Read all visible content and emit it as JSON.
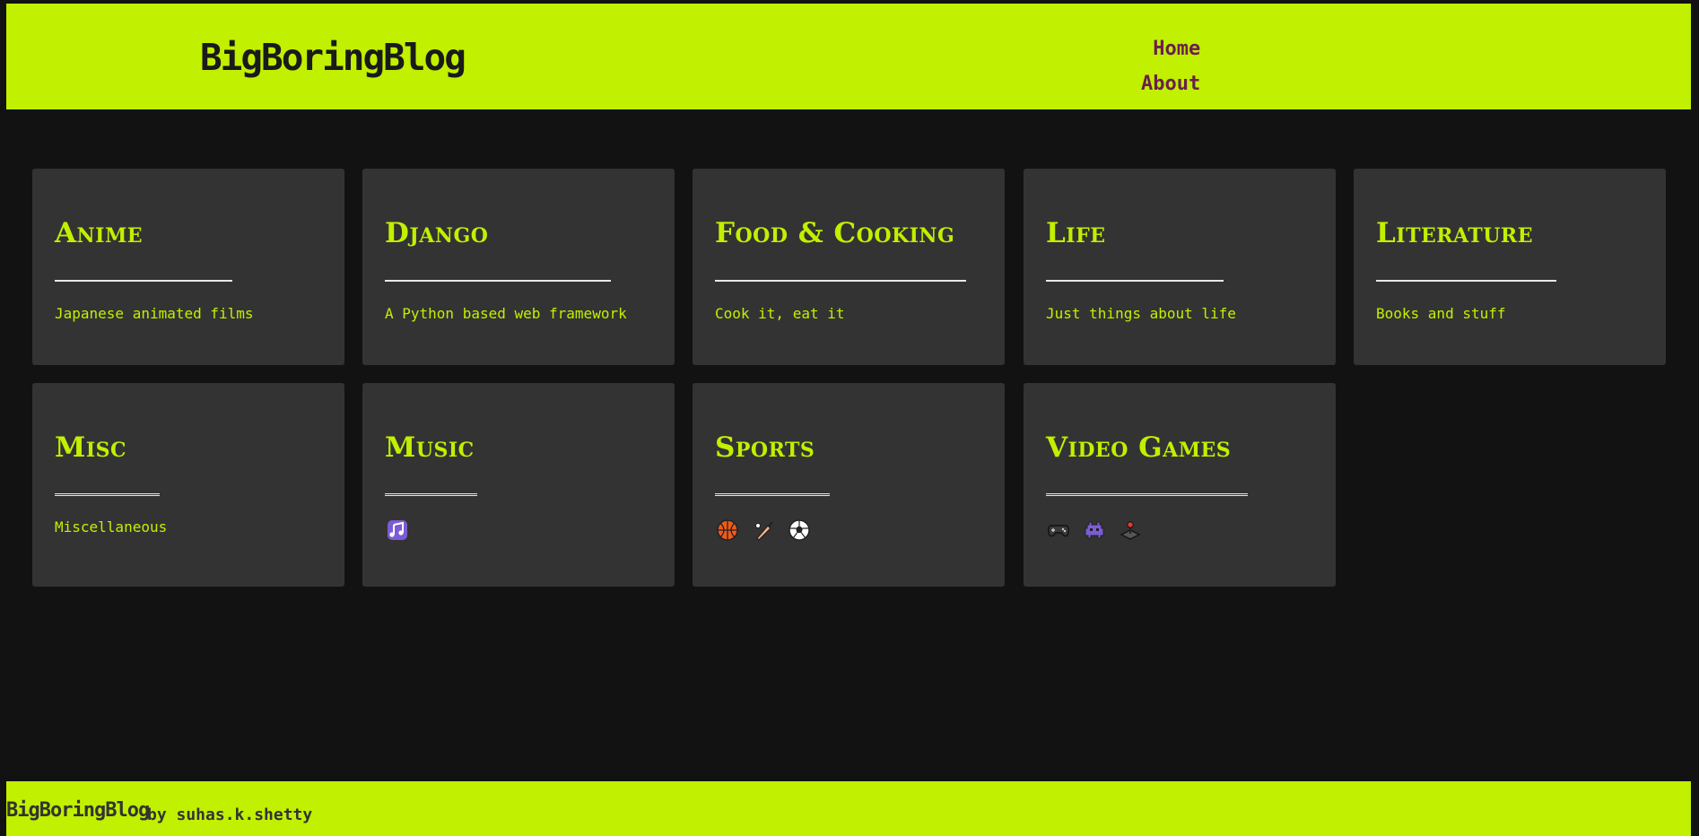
{
  "header": {
    "brand": "BigBoringBlog",
    "nav": [
      {
        "label": "Home"
      },
      {
        "label": "About"
      }
    ]
  },
  "categories": [
    {
      "title": "Anime",
      "description": "Japanese animated films",
      "icons": []
    },
    {
      "title": "Django",
      "description": "A Python based web framework",
      "icons": []
    },
    {
      "title": "Food & Cooking",
      "description": "Cook it, eat it",
      "icons": []
    },
    {
      "title": "Life",
      "description": "Just things about life",
      "icons": []
    },
    {
      "title": "Literature",
      "description": "Books and stuff",
      "icons": []
    },
    {
      "title": "Misc",
      "description": "Miscellaneous",
      "icons": []
    },
    {
      "title": "Music",
      "description": "",
      "icons": [
        "musical-notes-icon"
      ]
    },
    {
      "title": "Sports",
      "description": "",
      "icons": [
        "basketball-icon",
        "cricket-bat-icon",
        "soccer-ball-icon"
      ]
    },
    {
      "title": "Video Games",
      "description": "",
      "icons": [
        "game-controller-icon",
        "space-invader-icon",
        "joystick-icon"
      ]
    }
  ],
  "footer": {
    "brand": "BigBoringBlog",
    "byline": "by suhas.k.shetty"
  },
  "colors": {
    "accent": "#c1f000",
    "background": "#121212",
    "card": "#333333",
    "nav_link": "#6b1f4e"
  }
}
